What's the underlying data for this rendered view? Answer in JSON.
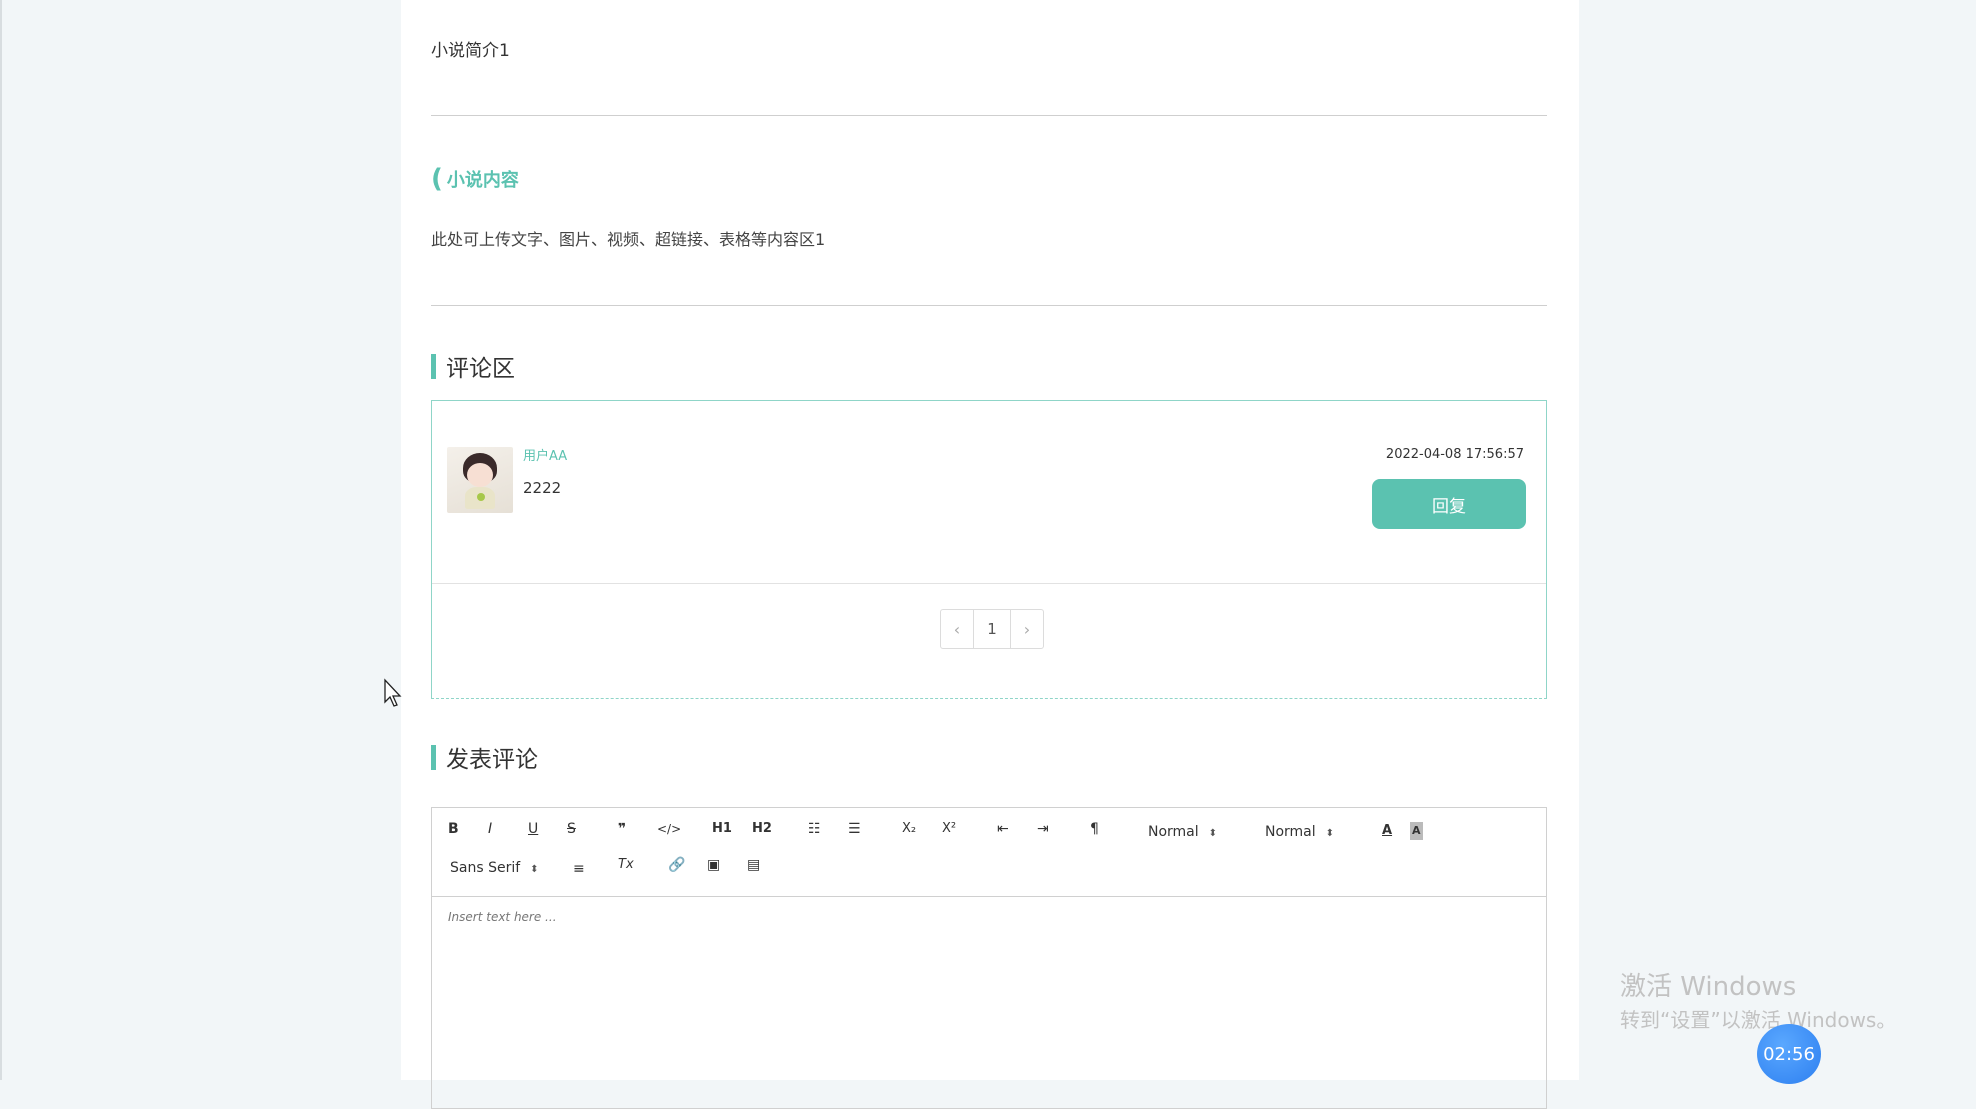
{
  "intro_text": "小说简介1",
  "content_section": {
    "title": "小说内容",
    "body": "此处可上传文字、图片、视频、超链接、表格等内容区1"
  },
  "comments_section": {
    "title": "评论区",
    "comments": [
      {
        "user": "用户AA",
        "text": "2222",
        "time": "2022-04-08 17:56:57",
        "reply_label": "回复"
      }
    ],
    "pagination": {
      "prev": "‹",
      "current": "1",
      "next": "›"
    }
  },
  "post_section": {
    "title": "发表评论",
    "editor": {
      "toolbar": {
        "bold": "B",
        "italic": "I",
        "underline": "U",
        "strike": "S",
        "blockquote": "❞",
        "code": "</>",
        "h1": "H1",
        "h2": "H2",
        "ordered_list": "☷",
        "bullet_list": "☰",
        "sub": "X₂",
        "sup": "X²",
        "outdent": "⇤",
        "indent": "⇥",
        "direction": "¶",
        "size_value": "Normal",
        "header_value": "Normal",
        "color": "A",
        "background": "A",
        "font_value": "Sans Serif",
        "align": "≡",
        "clean": "Tx",
        "link": "🔗",
        "image": "▣",
        "video": "▤"
      },
      "placeholder": "Insert text here ..."
    }
  },
  "watermark": {
    "title": "激活 Windows",
    "subtitle": "转到“设置”以激活 Windows。"
  },
  "timer": "02:56",
  "colors": {
    "accent": "#5bc2b0",
    "timer": "#2d7ff0"
  }
}
